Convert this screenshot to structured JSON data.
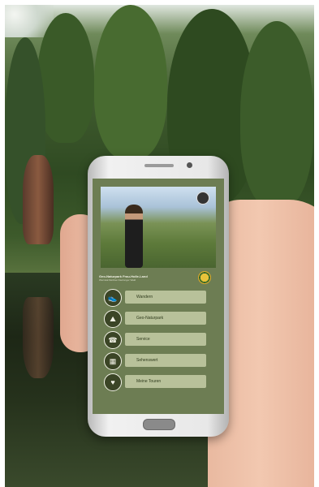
{
  "app": {
    "title": "Geo-Naturpark Frau-Holle-Land",
    "subtitle": "Werratal.Meißner.Kaufunger Wald"
  },
  "menu": [
    {
      "label": "Wandern",
      "icon": "hiking-boot-icon",
      "glyph": "👟"
    },
    {
      "label": "Geo-Naturpark",
      "icon": "mountain-icon",
      "glyph": "⛰"
    },
    {
      "label": "Service",
      "icon": "phone-icon",
      "glyph": "☎"
    },
    {
      "label": "Sehenswert",
      "icon": "building-icon",
      "glyph": "▦"
    },
    {
      "label": "Meine Touren",
      "icon": "heart-icon",
      "glyph": "♥"
    }
  ],
  "colors": {
    "screen_bg": "#6d7d53",
    "menu_bg": "#b8c19a",
    "icon_bg": "#3b4526"
  }
}
